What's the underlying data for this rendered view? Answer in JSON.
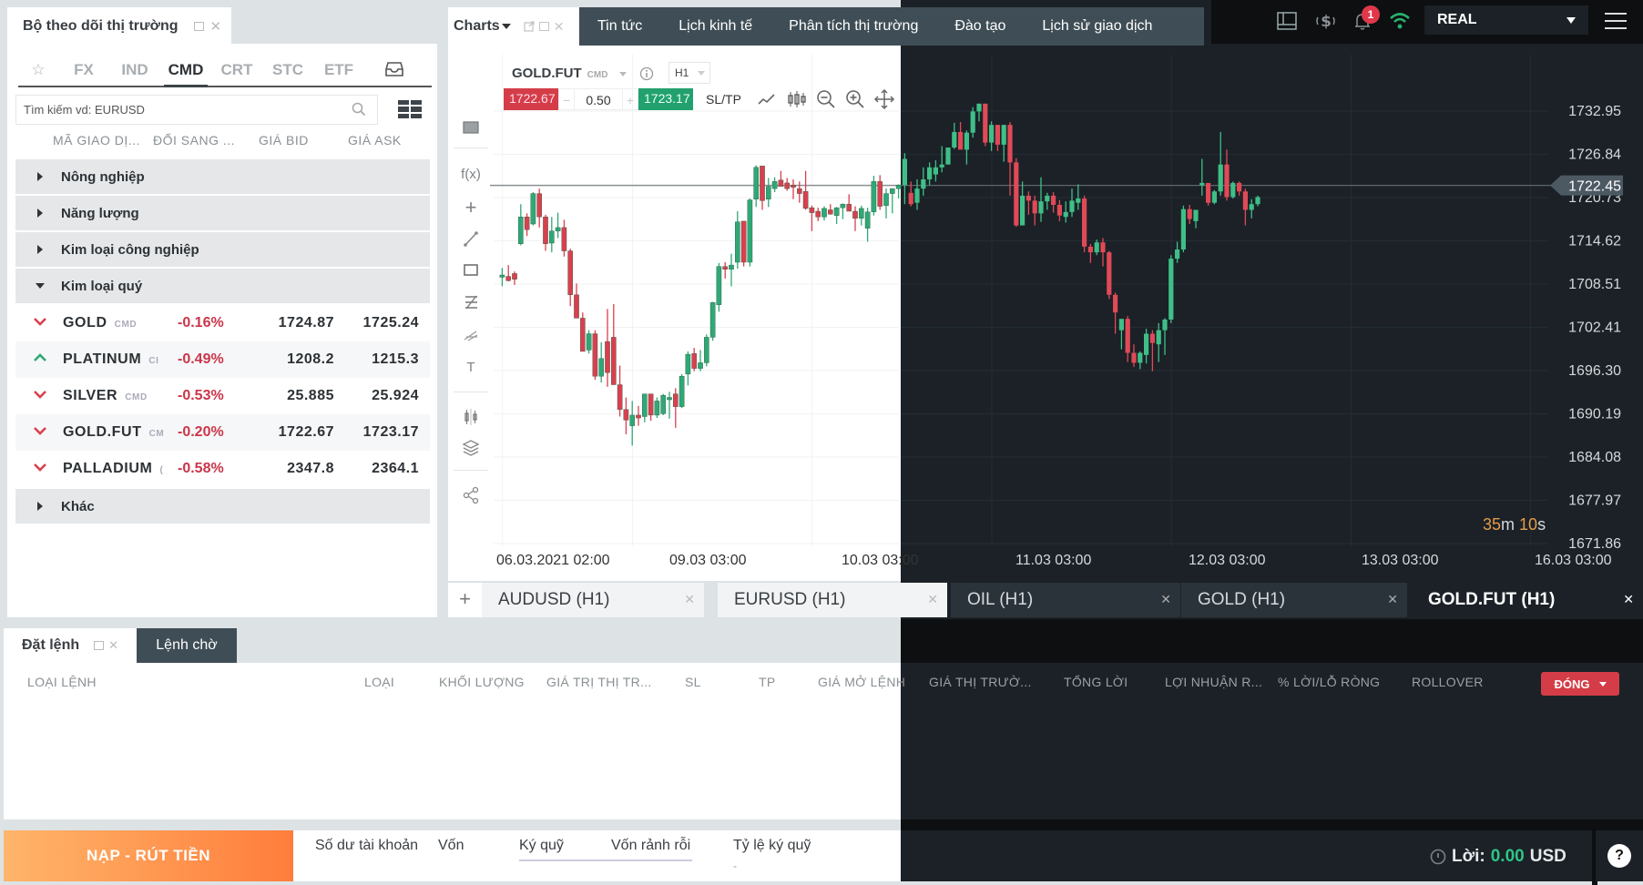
{
  "market_watch": {
    "title": "Bộ theo dõi thị trường",
    "categories": [
      {
        "label": "☆",
        "name": "favorites",
        "active": false
      },
      {
        "label": "FX",
        "name": "fx",
        "active": false
      },
      {
        "label": "IND",
        "name": "ind",
        "active": false
      },
      {
        "label": "CMD",
        "name": "cmd",
        "active": true
      },
      {
        "label": "CRT",
        "name": "crt",
        "active": false
      },
      {
        "label": "STC",
        "name": "stc",
        "active": false
      },
      {
        "label": "ETF",
        "name": "etf",
        "active": false
      }
    ],
    "search_placeholder": "Tìm kiếm vd: EURUSD",
    "columns": [
      "MÃ GIAO DỊ...",
      "ĐỔI SANG ...",
      "GIÁ BID",
      "GIÁ ASK"
    ],
    "groups_before": [
      "Nông nghiệp",
      "Năng lượng",
      "Kim loại công nghiệp"
    ],
    "expanded_group": "Kim loại quý",
    "rows": [
      {
        "symbol": "GOLD",
        "tag": "CMD",
        "direction": "down",
        "change": "-0.16%",
        "bid": "1724.87",
        "ask": "1725.24"
      },
      {
        "symbol": "PLATINUM",
        "tag": "CI",
        "direction": "up",
        "change": "-0.49%",
        "bid": "1208.2",
        "ask": "1215.3"
      },
      {
        "symbol": "SILVER",
        "tag": "CMD",
        "direction": "down",
        "change": "-0.53%",
        "bid": "25.885",
        "ask": "25.924"
      },
      {
        "symbol": "GOLD.FUT",
        "tag": "CM",
        "direction": "down",
        "change": "-0.20%",
        "bid": "1722.67",
        "ask": "1723.17"
      },
      {
        "symbol": "PALLADIUM",
        "tag": "(",
        "direction": "down",
        "change": "-0.58%",
        "bid": "2347.8",
        "ask": "2364.1"
      }
    ],
    "groups_after": [
      "Khác"
    ]
  },
  "header": {
    "charts_tab": "Charts",
    "nav_tabs": [
      "Tin tức",
      "Lịch kinh tế",
      "Phân tích thị trường",
      "Đào tạo",
      "Lịch sử giao dịch"
    ],
    "notification_count": "1",
    "account_type": "REAL"
  },
  "chart_panel": {
    "symbol": "GOLD.FUT",
    "symbol_tag": "CMD",
    "timeframe": "H1",
    "sell_price": "1722.67",
    "lot_size": "0.50",
    "buy_price": "1723.17",
    "sltp_label": "SL/TP",
    "countdown": {
      "minutes": "35",
      "m": "m ",
      "seconds": "10",
      "s": "s"
    },
    "tabs": [
      {
        "label": "AUDUSD (H1)",
        "active": false
      },
      {
        "label": "EURUSD (H1)",
        "active": false
      },
      {
        "label": "OIL (H1)",
        "active": false
      },
      {
        "label": "GOLD (H1)",
        "active": false
      },
      {
        "label": "GOLD.FUT (H1)",
        "active": true
      }
    ]
  },
  "chart_data": {
    "type": "candlestick",
    "title": "GOLD.FUT H1",
    "xlabel": "",
    "ylabel": "",
    "ylim": [
      1671.86,
      1732.95
    ],
    "y_ticks": [
      "1732.95",
      "1726.84",
      "1720.73",
      "1714.62",
      "1708.51",
      "1702.41",
      "1696.30",
      "1690.19",
      "1684.08",
      "1677.97",
      "1671.86"
    ],
    "x_ticks": [
      "06.03.2021 02:00",
      "09.03 03:00",
      "10.03 03:00",
      "11.03 03:00",
      "12.03 03:00",
      "13.03 03:00",
      "16.03 03:00"
    ],
    "x_tick_index": [
      3,
      24,
      53,
      82,
      111,
      140,
      169
    ],
    "current_price": 1722.45,
    "current_price_label": "1722.45",
    "candles": [
      [
        1709.5,
        1710.8,
        1708.2,
        1709.8
      ],
      [
        1709.6,
        1711.2,
        1708.9,
        1709.0
      ],
      [
        1710.0,
        1710.3,
        1708.4,
        1709.2
      ],
      [
        1714.2,
        1719.8,
        1714.0,
        1718.0
      ],
      [
        1718.0,
        1718.5,
        1715.3,
        1716.2
      ],
      [
        1717.0,
        1721.5,
        1716.8,
        1721.3
      ],
      [
        1721.3,
        1722.0,
        1716.5,
        1718.0
      ],
      [
        1718.0,
        1718.3,
        1713.2,
        1714.2
      ],
      [
        1714.3,
        1718.0,
        1713.0,
        1716.0
      ],
      [
        1716.0,
        1718.6,
        1715.0,
        1716.5
      ],
      [
        1716.5,
        1717.6,
        1712.4,
        1713.2
      ],
      [
        1713.2,
        1713.5,
        1705.4,
        1707.0
      ],
      [
        1707.0,
        1708.6,
        1703.8,
        1703.7
      ],
      [
        1703.7,
        1704.5,
        1701.2,
        1699.0
      ],
      [
        1699.2,
        1702.0,
        1698.7,
        1701.5
      ],
      [
        1701.5,
        1702.0,
        1695.0,
        1695.5
      ],
      [
        1695.5,
        1700.3,
        1694.6,
        1698.0
      ],
      [
        1700.4,
        1705.0,
        1694.0,
        1696.0
      ],
      [
        1701.0,
        1705.7,
        1697.0,
        1694.3
      ],
      [
        1694.3,
        1697.0,
        1689.8,
        1690.8
      ],
      [
        1690.8,
        1692.5,
        1687.3,
        1689.3
      ],
      [
        1688.5,
        1692.0,
        1685.7,
        1690.0
      ],
      [
        1690.0,
        1691.3,
        1688.5,
        1689.6
      ],
      [
        1689.8,
        1693.0,
        1689.0,
        1693.0
      ],
      [
        1693.0,
        1693.0,
        1689.2,
        1690.0
      ],
      [
        1690.0,
        1692.5,
        1689.6,
        1692.0
      ],
      [
        1690.2,
        1693.0,
        1690.0,
        1692.8
      ],
      [
        1692.5,
        1693.3,
        1689.5,
        1692.5
      ],
      [
        1693.0,
        1693.8,
        1688.2,
        1691.2
      ],
      [
        1691.2,
        1695.8,
        1691.0,
        1695.5
      ],
      [
        1695.8,
        1699.0,
        1694.2,
        1698.6
      ],
      [
        1698.7,
        1699.5,
        1696.2,
        1696.6
      ],
      [
        1696.6,
        1699.2,
        1696.2,
        1697.4
      ],
      [
        1697.4,
        1701.4,
        1696.9,
        1701.0
      ],
      [
        1701.0,
        1706.0,
        1700.5,
        1705.9
      ],
      [
        1705.6,
        1711.5,
        1704.6,
        1711.0
      ],
      [
        1711.0,
        1711.6,
        1709.3,
        1710.6
      ],
      [
        1710.6,
        1712.8,
        1708.2,
        1711.2
      ],
      [
        1711.6,
        1718.8,
        1710.7,
        1717.3
      ],
      [
        1717.4,
        1717.4,
        1711.0,
        1711.6
      ],
      [
        1711.6,
        1720.6,
        1711.0,
        1720.4
      ],
      [
        1720.5,
        1725.3,
        1719.4,
        1725.0
      ],
      [
        1725.2,
        1725.0,
        1719.0,
        1720.3
      ],
      [
        1720.5,
        1723.5,
        1719.4,
        1722.3
      ],
      [
        1722.0,
        1723.6,
        1721.5,
        1723.0
      ],
      [
        1723.2,
        1724.5,
        1722.6,
        1722.3
      ],
      [
        1722.8,
        1723.5,
        1721.7,
        1722.0
      ],
      [
        1722.5,
        1723.3,
        1720.5,
        1722.2
      ],
      [
        1722.0,
        1723.0,
        1720.0,
        1721.3
      ],
      [
        1721.6,
        1724.5,
        1719.0,
        1719.2
      ],
      [
        1719.3,
        1719.6,
        1716.0,
        1718.6
      ],
      [
        1718.8,
        1719.3,
        1717.4,
        1718.0
      ],
      [
        1718.0,
        1719.5,
        1717.5,
        1719.2
      ],
      [
        1719.0,
        1719.8,
        1718.3,
        1718.4
      ],
      [
        1718.2,
        1719.4,
        1717.0,
        1719.3
      ],
      [
        1719.3,
        1719.9,
        1717.7,
        1719.8
      ],
      [
        1719.8,
        1721.2,
        1719.0,
        1718.8
      ],
      [
        1718.8,
        1719.5,
        1716.0,
        1717.8
      ],
      [
        1717.8,
        1719.6,
        1716.8,
        1719.2
      ],
      [
        1716.4,
        1719.3,
        1714.5,
        1718.7
      ],
      [
        1718.7,
        1723.8,
        1718.2,
        1723.0
      ],
      [
        1723.0,
        1723.9,
        1719.0,
        1719.5
      ],
      [
        1719.6,
        1722.0,
        1717.8,
        1721.3
      ],
      [
        1721.3,
        1722.0,
        1718.5,
        1722.0
      ],
      [
        1722.0,
        1722.6,
        1720.6,
        1722.5
      ],
      [
        1722.5,
        1727.0,
        1719.8,
        1726.2
      ],
      [
        1721.4,
        1723.0,
        1719.5,
        1719.8
      ],
      [
        1720.0,
        1723.3,
        1719.0,
        1722.0
      ],
      [
        1722.0,
        1725.0,
        1721.0,
        1723.3
      ],
      [
        1723.3,
        1725.7,
        1722.5,
        1725.0
      ],
      [
        1724.0,
        1726.0,
        1723.0,
        1725.0
      ],
      [
        1725.0,
        1728.0,
        1724.3,
        1725.4
      ],
      [
        1725.4,
        1727.6,
        1726.0,
        1727.8
      ],
      [
        1727.8,
        1731.3,
        1727.6,
        1730.0
      ],
      [
        1730.0,
        1731.4,
        1728.2,
        1727.5
      ],
      [
        1727.5,
        1730.2,
        1725.4,
        1729.9
      ],
      [
        1729.9,
        1733.5,
        1729.2,
        1732.9
      ],
      [
        1732.9,
        1734.0,
        1731.5,
        1734.0
      ],
      [
        1734.0,
        1734.0,
        1728.0,
        1728.5
      ],
      [
        1728.5,
        1731.5,
        1727.3,
        1731.0
      ],
      [
        1731.0,
        1731.0,
        1727.3,
        1728.2
      ],
      [
        1728.2,
        1731.0,
        1725.8,
        1731.0
      ],
      [
        1731.0,
        1731.4,
        1721.0,
        1725.7
      ],
      [
        1725.7,
        1726.3,
        1716.6,
        1716.8
      ],
      [
        1716.8,
        1723.0,
        1717.3,
        1721.0
      ],
      [
        1721.0,
        1721.6,
        1718.3,
        1720.3
      ],
      [
        1720.3,
        1721.0,
        1716.8,
        1718.5
      ],
      [
        1718.5,
        1723.6,
        1717.3,
        1720.2
      ],
      [
        1720.2,
        1721.4,
        1719.0,
        1721.0
      ],
      [
        1721.0,
        1721.5,
        1718.6,
        1719.7
      ],
      [
        1719.7,
        1720.4,
        1717.4,
        1718.2
      ],
      [
        1718.0,
        1720.2,
        1717.2,
        1718.7
      ],
      [
        1718.7,
        1722.0,
        1718.0,
        1720.3
      ],
      [
        1720.0,
        1722.6,
        1719.0,
        1720.6
      ],
      [
        1720.6,
        1721.0,
        1713.0,
        1713.8
      ],
      [
        1713.8,
        1714.2,
        1711.5,
        1713.0
      ],
      [
        1713.0,
        1714.8,
        1712.6,
        1714.4
      ],
      [
        1714.4,
        1715.0,
        1711.0,
        1713.0
      ],
      [
        1713.0,
        1713.2,
        1706.4,
        1707.0
      ],
      [
        1707.0,
        1707.3,
        1701.5,
        1704.5
      ],
      [
        1702.0,
        1703.4,
        1699.3,
        1703.6
      ],
      [
        1703.6,
        1704.0,
        1697.5,
        1698.8
      ],
      [
        1698.8,
        1700.0,
        1696.8,
        1697.4
      ],
      [
        1697.4,
        1699.0,
        1696.5,
        1698.8
      ],
      [
        1698.5,
        1702.2,
        1697.3,
        1701.5
      ],
      [
        1701.5,
        1702.0,
        1696.2,
        1700.2
      ],
      [
        1700.0,
        1703.0,
        1697.5,
        1702.0
      ],
      [
        1702.0,
        1703.7,
        1698.5,
        1703.5
      ],
      [
        1703.5,
        1712.6,
        1703.0,
        1712.1
      ],
      [
        1712.1,
        1714.5,
        1711.5,
        1713.4
      ],
      [
        1713.4,
        1719.6,
        1713.0,
        1719.1
      ],
      [
        1719.1,
        1719.7,
        1717.0,
        1717.7
      ],
      [
        1717.4,
        1719.0,
        1716.4,
        1719.0
      ],
      [
        1722.5,
        1726.2,
        1721.0,
        1722.8
      ],
      [
        1722.8,
        1722.7,
        1719.6,
        1720.0
      ],
      [
        1720.0,
        1721.8,
        1719.8,
        1721.6
      ],
      [
        1721.6,
        1730.0,
        1721.0,
        1725.4
      ],
      [
        1725.4,
        1727.5,
        1720.3,
        1720.8
      ],
      [
        1720.8,
        1723.0,
        1720.6,
        1722.8
      ],
      [
        1722.8,
        1723.0,
        1721.0,
        1721.6
      ],
      [
        1721.6,
        1722.0,
        1716.8,
        1719.0
      ],
      [
        1719.0,
        1720.5,
        1717.8,
        1719.8
      ],
      [
        1719.8,
        1721.0,
        1719.5,
        1720.8
      ]
    ]
  },
  "orders_panel": {
    "tab_active": "Đặt lệnh",
    "tab_pending": "Lệnh chờ",
    "columns": [
      "LOẠI LỆNH",
      "LOẠI",
      "KHỐI LƯỢNG",
      "GIÁ TRỊ THỊ TR...",
      "SL",
      "TP",
      "GIÁ MỞ LỆNH",
      "GIÁ THỊ TRƯỜ...",
      "TỔNG LỜI",
      "LỢI NHUẬN R...",
      "% LỜI/LỖ RÒNG",
      "ROLLOVER"
    ],
    "close_button": "ĐÓNG"
  },
  "footer": {
    "deposit_button": "NẠP - RÚT TIỀN",
    "labels": [
      "Số dư tài khoản",
      "Vốn",
      "Ký quỹ",
      "Vốn rảnh rỗi",
      "Tỷ lệ ký quỹ"
    ],
    "margin_ratio_value": "-",
    "profit_label": "Lời:",
    "profit_value": "0.00",
    "profit_currency": "USD",
    "help": "?"
  },
  "colors": {
    "up": "#2fa876",
    "down": "#d9404e",
    "up_dark": "#3fbf87",
    "down_dark": "#e04a57",
    "nav_bg": "#3f4e56",
    "deposit_from": "#ffb56a",
    "deposit_to": "#ff7d3b"
  }
}
